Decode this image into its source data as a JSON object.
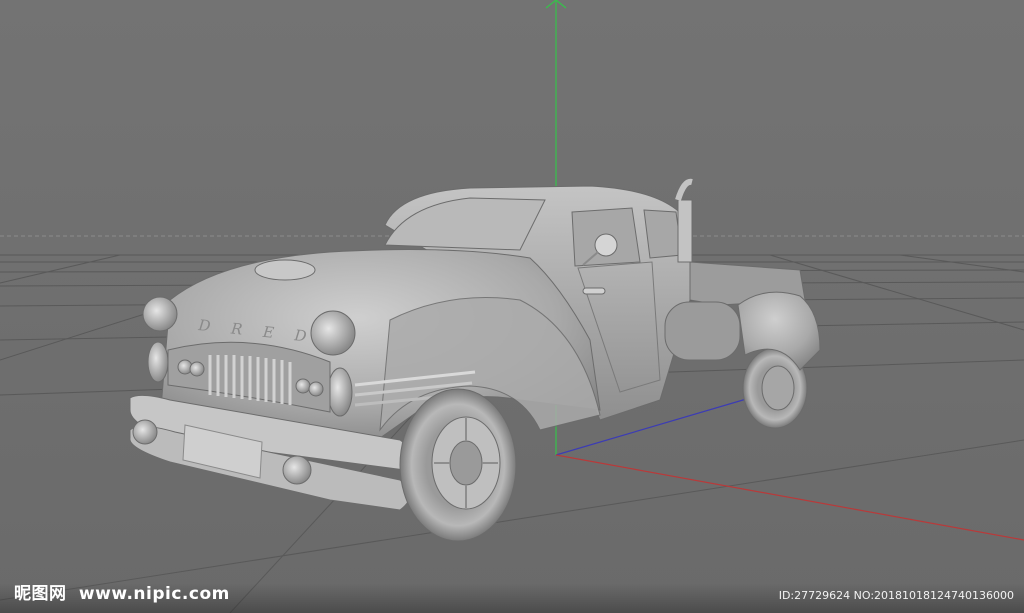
{
  "viewport": {
    "background": "#707070",
    "grid_color": "#5a5a5a",
    "horizon_line_color": "#8c8c8c",
    "axis_colors": {
      "x": "#b83a3a",
      "y": "#36c24a",
      "z": "#3c3cb4"
    }
  },
  "model": {
    "emblem_text": "D R E D",
    "body_color": "#b4b4b4"
  },
  "watermark": {
    "site_cn": "昵图网",
    "site_url": "www.nipic.com",
    "id_text": "ID:27729624 NO:20181018124740136000"
  }
}
